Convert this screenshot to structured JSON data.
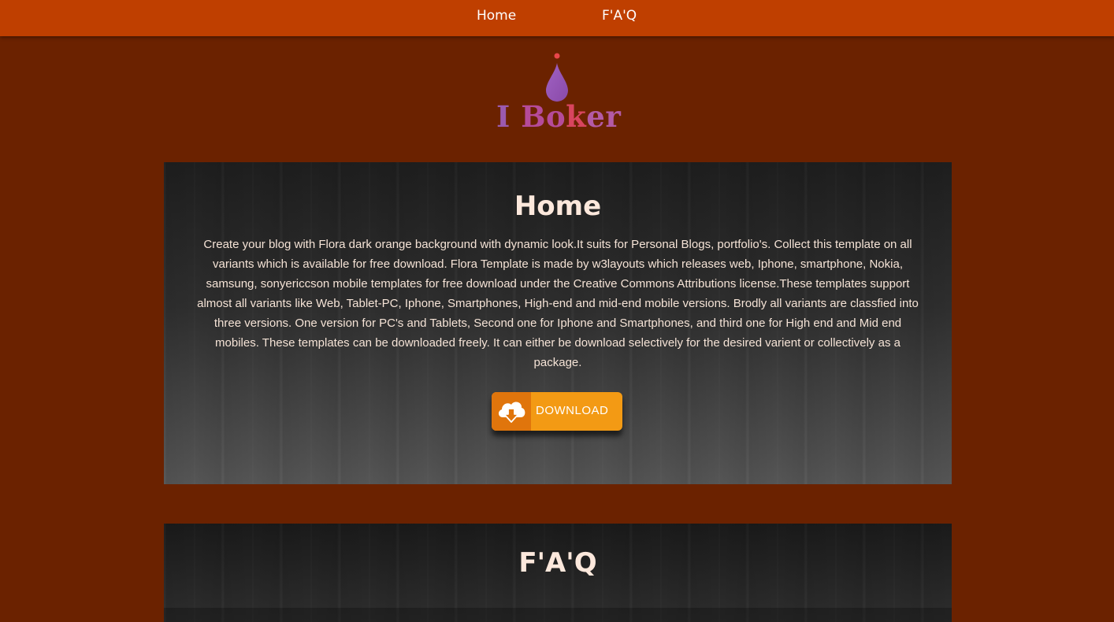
{
  "nav": {
    "items": [
      {
        "label": "Home"
      },
      {
        "label": "F'A'Q"
      }
    ]
  },
  "logo": {
    "text_i": "I ",
    "text_bo": "Bo",
    "text_k": "k",
    "text_er": "er"
  },
  "sections": {
    "home": {
      "title": "Home",
      "body": "Create your blog with Flora dark orange background with dynamic look.It suits for Personal Blogs, portfolio's. Collect this template on all variants which is available for free download. Flora Template is made by w3layouts which releases web, Iphone, smartphone, Nokia, samsung, sonyericcson mobile templates for free download under the Creative Commons Attributions license.These templates support almost all variants like Web, Tablet-PC, Iphone, Smartphones, High-end and mid-end mobile versions. Brodly all variants are classfied into three versions. One version for PC's and Tablets, Second one for Iphone and Smartphones, and third one for High end and Mid end mobiles. These templates can be downloaded freely. It can either be download selectively for the desired varient or collectively as a package.",
      "download_label": "DOWNLOAD"
    },
    "faq": {
      "title": "F'A'Q"
    }
  },
  "colors": {
    "page_bg": "#6b2200",
    "nav_bg": "#bf3f00",
    "button_orange": "#f39a14",
    "button_icon_bg": "#e0750c",
    "logo_purple": "#9b5aaf",
    "logo_red": "#d8455f"
  },
  "icons": {
    "logo": "droplet-logo-icon",
    "download": "cloud-download-icon"
  }
}
